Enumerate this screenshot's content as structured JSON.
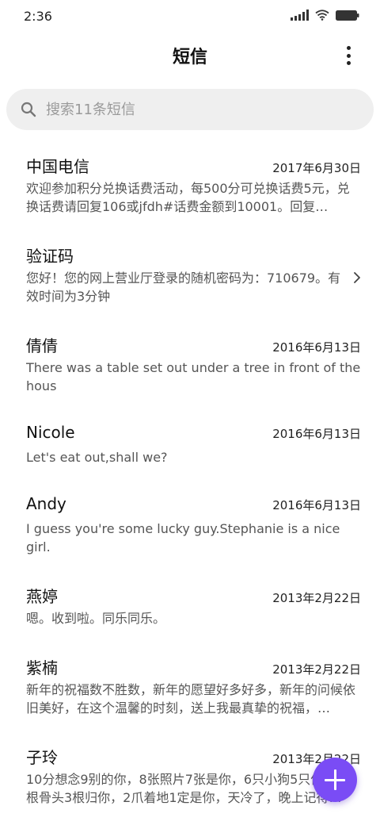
{
  "status_bar": {
    "time": "2:36"
  },
  "header": {
    "title": "短信"
  },
  "search": {
    "placeholder": "搜索11条短信"
  },
  "messages": [
    {
      "sender": "中国电信",
      "date": "2017年6月30日",
      "preview": "欢迎参加积分兑换话费活动，每500分可兑换话费5元，兑换话费请回复106或jfdh#话费金额到10001。回复…"
    },
    {
      "sender": "验证码",
      "date": "",
      "preview": "您好！您的网上营业厅登录的随机密码为：710679。有效时间为3分钟"
    },
    {
      "sender": "倩倩",
      "date": "2016年6月13日",
      "preview": "There was a table set out under a tree in front of the hous"
    },
    {
      "sender": "Nicole",
      "date": "2016年6月13日",
      "preview": "Let's eat out,shall we?"
    },
    {
      "sender": "Andy",
      "date": "2016年6月13日",
      "preview": "I guess you're some lucky guy.Stephanie is a nice girl."
    },
    {
      "sender": "燕婷",
      "date": "2013年2月22日",
      "preview": "嗯。收到啦。同乐同乐。"
    },
    {
      "sender": "紫楠",
      "date": "2013年2月22日",
      "preview": "新年的祝福数不胜数，新年的愿望好多好多，新年的问候依旧美好，在这个温馨的时刻，送上我最真挚的祝福，…"
    },
    {
      "sender": "子玲",
      "date": "2013年2月22日",
      "preview": "10分想念9别的你，8张照片7张是你，6只小狗5只像你，4根骨头3根归你，2爪着地1定是你，天冷了，晚上记得…"
    }
  ],
  "fab": {
    "icon": "plus-icon",
    "color": "#7a4cf5"
  }
}
